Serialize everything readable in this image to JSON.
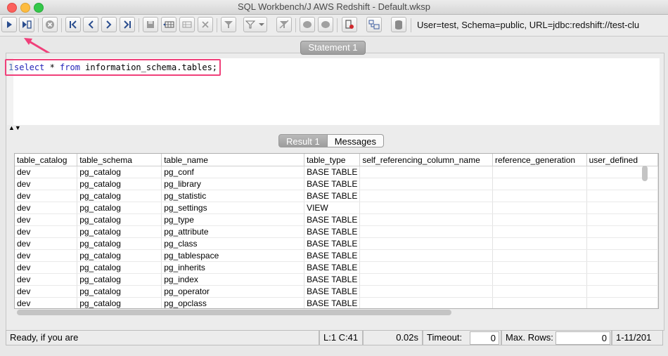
{
  "window": {
    "title": "SQL Workbench/J AWS Redshift - Default.wksp"
  },
  "toolbar": {
    "connection_info": "User=test, Schema=public, URL=jdbc:redshift://test-clu",
    "buttons": [
      "execute-icon",
      "execute-current-icon",
      "stop-icon",
      "first-icon",
      "prev-icon",
      "next-icon",
      "last-icon",
      "save-icon",
      "insert-row-icon",
      "copy-row-icon",
      "delete-row-icon",
      "filter-icon",
      "filter-dropdown-icon",
      "clear-filter-icon",
      "commit-icon",
      "rollback-icon",
      "disconnect-icon",
      "object-explorer-icon",
      "database-icon"
    ]
  },
  "editor": {
    "tab_label": "Statement 1",
    "line_number": "1",
    "sql_keyword_1": "select",
    "sql_middle": " * ",
    "sql_keyword_2": "from",
    "sql_rest": " information_schema.tables;"
  },
  "results": {
    "tabs": [
      "Result 1",
      "Messages"
    ],
    "columns": [
      "table_catalog",
      "table_schema",
      "table_name",
      "table_type",
      "self_referencing_column_name",
      "reference_generation",
      "user_defined"
    ],
    "rows": [
      [
        "dev",
        "pg_catalog",
        "pg_conf",
        "BASE TABLE",
        "",
        "",
        ""
      ],
      [
        "dev",
        "pg_catalog",
        "pg_library",
        "BASE TABLE",
        "",
        "",
        ""
      ],
      [
        "dev",
        "pg_catalog",
        "pg_statistic",
        "BASE TABLE",
        "",
        "",
        ""
      ],
      [
        "dev",
        "pg_catalog",
        "pg_settings",
        "VIEW",
        "",
        "",
        ""
      ],
      [
        "dev",
        "pg_catalog",
        "pg_type",
        "BASE TABLE",
        "",
        "",
        ""
      ],
      [
        "dev",
        "pg_catalog",
        "pg_attribute",
        "BASE TABLE",
        "",
        "",
        ""
      ],
      [
        "dev",
        "pg_catalog",
        "pg_class",
        "BASE TABLE",
        "",
        "",
        ""
      ],
      [
        "dev",
        "pg_catalog",
        "pg_tablespace",
        "BASE TABLE",
        "",
        "",
        ""
      ],
      [
        "dev",
        "pg_catalog",
        "pg_inherits",
        "BASE TABLE",
        "",
        "",
        ""
      ],
      [
        "dev",
        "pg_catalog",
        "pg_index",
        "BASE TABLE",
        "",
        "",
        ""
      ],
      [
        "dev",
        "pg_catalog",
        "pg_operator",
        "BASE TABLE",
        "",
        "",
        ""
      ],
      [
        "dev",
        "pg_catalog",
        "pg_opclass",
        "BASE TABLE",
        "",
        "",
        ""
      ]
    ]
  },
  "status": {
    "message": "Ready, if you are",
    "position": "L:1 C:41",
    "elapsed": "0.02s",
    "timeout_label": "Timeout:",
    "timeout_value": "0",
    "max_rows_label": "Max. Rows:",
    "max_rows_value": "0",
    "row_range": "1-11/201"
  },
  "colors": {
    "annotation": "#f0407a",
    "keyword": "#2424b8",
    "tab_active": "#a8a8a8"
  }
}
